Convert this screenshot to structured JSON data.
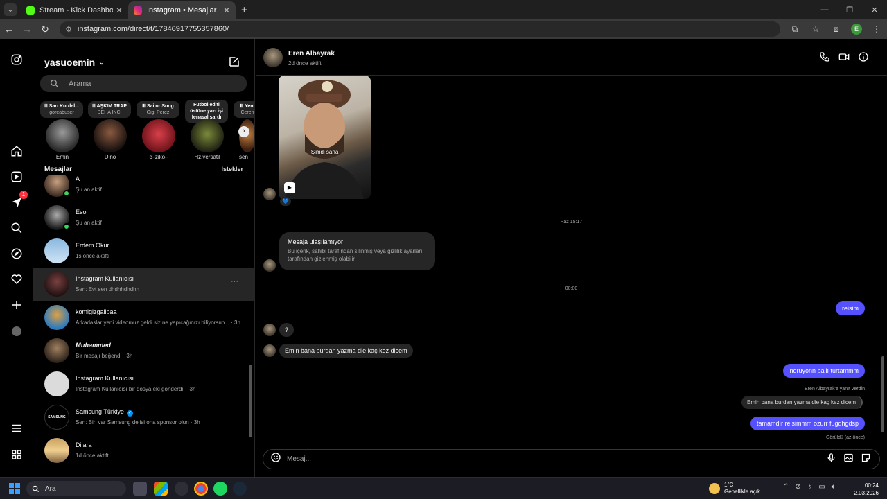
{
  "browser": {
    "tabs": [
      {
        "title": "Stream - Kick Dashboard",
        "active": false,
        "favicon_color": "#53fc18"
      },
      {
        "title": "Instagram • Mesajlar",
        "active": true,
        "favicon_color": "#e1306c"
      }
    ],
    "url": "instagram.com/direct/t/17846917755357860/",
    "profile_initial": "E"
  },
  "inbox": {
    "username": "yasuoemin",
    "search_placeholder": "Arama",
    "notes": [
      {
        "song": "Sarı Kurdel...",
        "artist": "goreabuser",
        "name": "Emin"
      },
      {
        "song": "AŞKIM TRAP",
        "artist": "DEHA INC.",
        "name": "Dino"
      },
      {
        "song": "Sailor Song",
        "artist": "Gigi Perez",
        "name": "c–ziko–"
      },
      {
        "song": "Futbol editi üstüne yazı işi fenasal sardı",
        "artist": "",
        "name": "Hz.versatil"
      },
      {
        "song": "Yeni",
        "artist": "Ceren",
        "name": "sen"
      }
    ],
    "section_title": "Mesajlar",
    "requests_label": "İstekler",
    "conversations": [
      {
        "name": "A",
        "sub": "Şu an aktif",
        "online": true,
        "selected": false
      },
      {
        "name": "Eso",
        "sub": "Şu an aktif",
        "online": true,
        "selected": false
      },
      {
        "name": "Erdem Okur",
        "sub": "1s önce aktifti",
        "online": false,
        "selected": false
      },
      {
        "name": "Instagram Kullanıcısı",
        "sub": "Sen: Evt sen dhdhhdhdhh",
        "online": false,
        "selected": true
      },
      {
        "name": "komigizgalibaa",
        "sub": "Arkadaslar yeni videomuz geldi siz ne yapıcağınızı biliyorsun... · 3h",
        "online": false,
        "selected": false
      },
      {
        "name": "𝑴𝒖𝒉𝒂𝒎𝒎𝒆𝒅",
        "sub": "Bir mesajı beğendi · 3h",
        "online": false,
        "selected": false
      },
      {
        "name": "Instagram Kullanıcısı",
        "sub": "Instagram Kullanıcısı bir dosya eki gönderdi. · 3h",
        "online": false,
        "selected": false
      },
      {
        "name": "Samsung Türkiye",
        "sub": "Sen: Biri var Samsung delisi ona sponsor olun · 3h",
        "online": false,
        "selected": false,
        "verified": true
      },
      {
        "name": "Dilara",
        "sub": "1d önce aktifti",
        "online": false,
        "selected": false
      }
    ],
    "rail_badge": "1"
  },
  "chat": {
    "contact_name": "Eren Albayrak",
    "contact_status": "2d önce aktifti",
    "reel_caption": "Şimdi sana",
    "reaction": "💙",
    "timestamp_1": "Paz 15:17",
    "unavailable_title": "Mesaja ulaşılamıyor",
    "unavailable_body": "Bu içerik, sahibi tarafından silinmiş veya gizlilik ayarları tarafından gizlenmiş olabilir.",
    "timestamp_2": "00:00",
    "msg_out_1": "reisim",
    "msg_in_1": "?",
    "msg_in_2": "Emin bana burdan yazma die kaç kez dicem",
    "msg_out_2": "noruyonn ballı turtammm",
    "reply_label": "Eren Albayrak'e yanıt verdin",
    "reply_quote": "Emin bana burdan yazma die kaç kez dicem",
    "msg_out_3": "tamamdır reisimmm ozurr fugdhgdsp",
    "seen": "Görüldü (az önce)",
    "composer_placeholder": "Mesaj..."
  },
  "taskbar": {
    "search_label": "Ara",
    "temperature": "1°C",
    "weather": "Genellikle açık",
    "time": "00:24",
    "date": "2.03.2026"
  }
}
